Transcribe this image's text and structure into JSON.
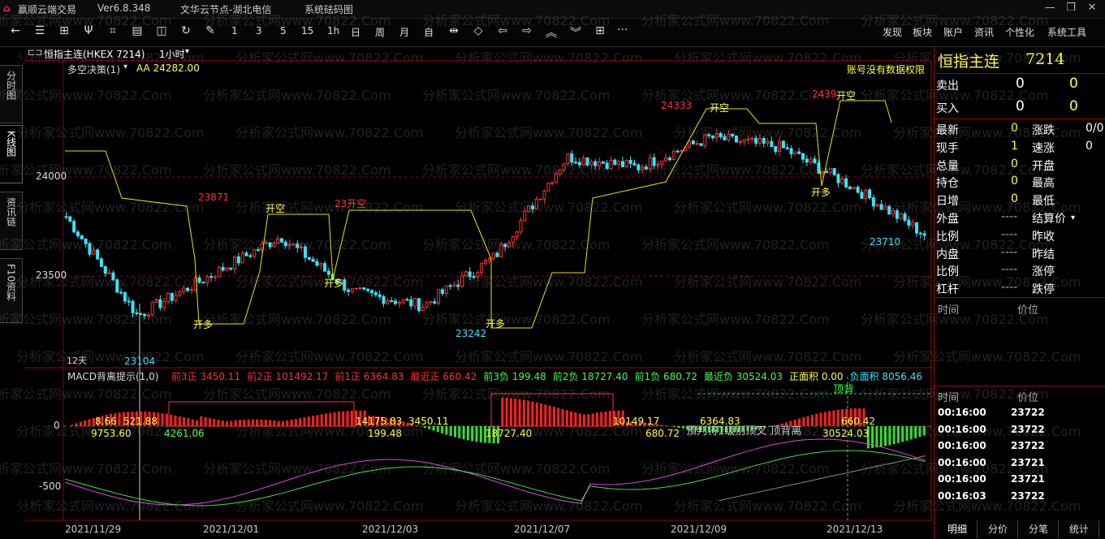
{
  "titlebar": {
    "app_name": "赢顺云端交易",
    "version": "Ver6.8.348",
    "node": "文华云节点-湖北电信",
    "extra": "系统砝码图"
  },
  "toolbar": {
    "periods": [
      "1",
      "3",
      "5",
      "15",
      "1h",
      "日",
      "周",
      "月",
      "自"
    ],
    "menu": [
      "发现",
      "板块",
      "账户",
      "资讯",
      "个性化",
      "系统工具"
    ],
    "more": "···"
  },
  "left_tabs": [
    "分时图",
    "K线图",
    "资讯链",
    "F10资料"
  ],
  "symbol_bar": {
    "name": "恒指主连(HKEX 7214)",
    "period": "1小时"
  },
  "main_chart": {
    "indicator": "多空决策(1)",
    "aa_label": "AA 24282.00",
    "no_permission": "账号没有数据权限",
    "price_ticks": [
      "24000",
      "23500"
    ],
    "labels": [
      {
        "text": "23871",
        "color": "#ff3030"
      },
      {
        "text": "开空",
        "color": "#ffff40"
      },
      {
        "text": "23开空",
        "color": "#ff3030"
      },
      {
        "text": "开多",
        "color": "#ffff40"
      },
      {
        "text": "开多",
        "color": "#ffff40"
      },
      {
        "text": "23242",
        "color": "#33e6ff"
      },
      {
        "text": "开多",
        "color": "#ffff40"
      },
      {
        "text": "24333",
        "color": "#ff3030"
      },
      {
        "text": "开空",
        "color": "#ffff40"
      },
      {
        "text": "2439",
        "color": "#ff3030"
      },
      {
        "text": "开空",
        "color": "#ffff40"
      },
      {
        "text": "开多",
        "color": "#ffff40"
      },
      {
        "text": "23710",
        "color": "#33e6ff"
      },
      {
        "text": "23104",
        "color": "#33e6ff"
      },
      {
        "text": "12天",
        "color": "#dddddd"
      }
    ]
  },
  "macd": {
    "title": "MACD背离提示(1,0)",
    "stats": [
      {
        "label": "前3正",
        "value": "3450.11",
        "color": "#ff3030"
      },
      {
        "label": "前2正",
        "value": "101492.17",
        "color": "#ff3030"
      },
      {
        "label": "前1正",
        "value": "6364.83",
        "color": "#ff3030"
      },
      {
        "label": "最近正",
        "value": "660.42",
        "color": "#ff3030"
      },
      {
        "label": "前3负",
        "value": "199.48",
        "color": "#40ff40"
      },
      {
        "label": "前2负",
        "value": "18727.40",
        "color": "#40ff40"
      },
      {
        "label": "前1负",
        "value": "680.72",
        "color": "#40ff40"
      },
      {
        "label": "最近负",
        "value": "30524.03",
        "color": "#40ff40"
      },
      {
        "label": "正面积",
        "value": "0.00",
        "color": "#ffff40"
      },
      {
        "label": "负面积",
        "value": "8056.46",
        "color": "#33e6ff"
      }
    ],
    "top_divergence": "顶背",
    "warning": "預判将1级别顶叉 顶背离",
    "y_ticks": [
      "0",
      "-500"
    ],
    "inline_values": [
      "8.66",
      "521.88",
      "9753.60",
      "4261.06",
      "14175.83",
      "3450.11",
      "199.48",
      "18727.40",
      "10149.17",
      "680.72",
      "6364.83",
      "660.42",
      "30524.03"
    ]
  },
  "x_axis": [
    "2021/11/29",
    "2021/12/01",
    "2021/12/03",
    "2021/12/07",
    "2021/12/09",
    "2021/12/13"
  ],
  "quote_panel": {
    "title": "恒指主连",
    "code": "7214",
    "sell": {
      "label": "卖出",
      "price": "0",
      "qty": "0"
    },
    "buy": {
      "label": "买入",
      "price": "0",
      "qty": "0"
    },
    "rows": [
      {
        "l1": "最新",
        "v1": "0",
        "l2": "涨跌",
        "v2": "0/0"
      },
      {
        "l1": "现手",
        "v1": "1",
        "l2": "速涨",
        "v2": "0"
      },
      {
        "l1": "总量",
        "v1": "0",
        "l2": "开盘",
        "v2": ""
      },
      {
        "l1": "持仓",
        "v1": "0",
        "l2": "最高",
        "v2": ""
      },
      {
        "l1": "日增",
        "v1": "0",
        "l2": "最低",
        "v2": ""
      },
      {
        "l1": "外盘",
        "v1": "----",
        "l2": "结算价",
        "v2": ""
      },
      {
        "l1": "比例",
        "v1": "----",
        "l2": "昨收",
        "v2": ""
      },
      {
        "l1": "内盘",
        "v1": "----",
        "l2": "昨结",
        "v2": ""
      },
      {
        "l1": "比例",
        "v1": "----",
        "l2": "涨停",
        "v2": ""
      },
      {
        "l1": "杠杆",
        "v1": "----",
        "l2": "跌停",
        "v2": ""
      }
    ],
    "time_header": {
      "time": "时间",
      "price": "价位"
    },
    "ticks": [
      {
        "time": "00:16:00",
        "price": "23722"
      },
      {
        "time": "00:16:00",
        "price": "23722"
      },
      {
        "time": "00:16:00",
        "price": "23722"
      },
      {
        "time": "00:16:00",
        "price": "23721"
      },
      {
        "time": "00:16:00",
        "price": "23721"
      },
      {
        "time": "00:16:03",
        "price": "23722"
      }
    ],
    "bottom_tabs": [
      "明细",
      "分价",
      "分笔",
      "统计"
    ]
  },
  "watermark": "分析家公式网www.70822.Com",
  "chart_data": {
    "type": "candlestick",
    "title": "恒指主连(HKEX 7214) 1小时",
    "x": [
      "2021/11/29",
      "2021/12/01",
      "2021/12/03",
      "2021/12/07",
      "2021/12/09",
      "2021/12/13"
    ],
    "close_approx": [
      23800,
      23300,
      23500,
      23700,
      23420,
      23350,
      23600,
      24100,
      24050,
      24200,
      24150,
      23950,
      23710
    ],
    "annotated_points": {
      "high1": 23871,
      "low1": 23104,
      "low2": 23242,
      "high2": 24333,
      "high3": 2439,
      "last": 23710
    },
    "ylim": [
      23000,
      24500
    ],
    "y_ticks": [
      24000,
      23500
    ]
  }
}
